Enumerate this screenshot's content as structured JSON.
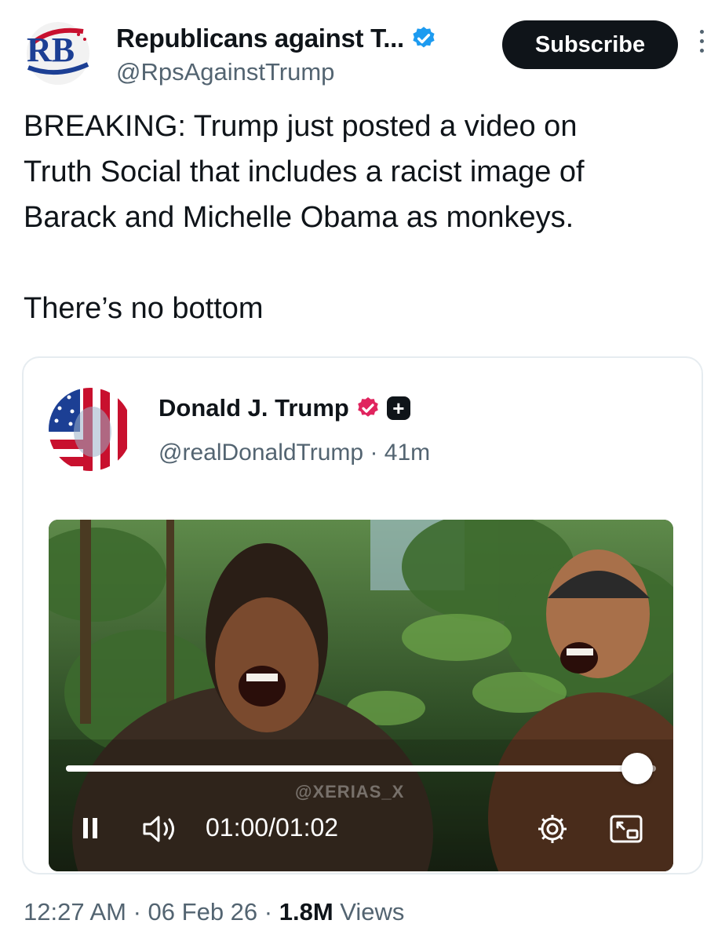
{
  "author": {
    "name": "Republicans against T...",
    "handle": "@RpsAgainstTrump",
    "avatar_text": "RB",
    "verified_icon": "verified-badge-icon"
  },
  "subscribe_label": "Subscribe",
  "tweet": {
    "lines": [
      "BREAKING: Trump just posted a video on",
      "Truth Social that includes a racist image of",
      "Barack and Michelle Obama as monkeys."
    ],
    "second_paragraph": "There’s no bottom"
  },
  "quoted": {
    "name": "Donald J. Trump",
    "handle": "@realDonaldTrump",
    "time_ago": "41m",
    "separator": " · ",
    "badge_icon": "verified-badge-icon",
    "plus_icon": "plus-icon"
  },
  "video": {
    "watermark": "@XERIAS_X",
    "time_display": "01:00/01:02",
    "progress": 0.968
  },
  "footer": {
    "time": "12:27 AM",
    "date": "06 Feb 26",
    "views_count": "1.8M",
    "views_label": "Views",
    "separator": " · "
  },
  "colors": {
    "text": "#0f1419",
    "secondary": "#536471",
    "verified_blue": "#1d9bf0",
    "truth_badge": "#e0245e"
  }
}
